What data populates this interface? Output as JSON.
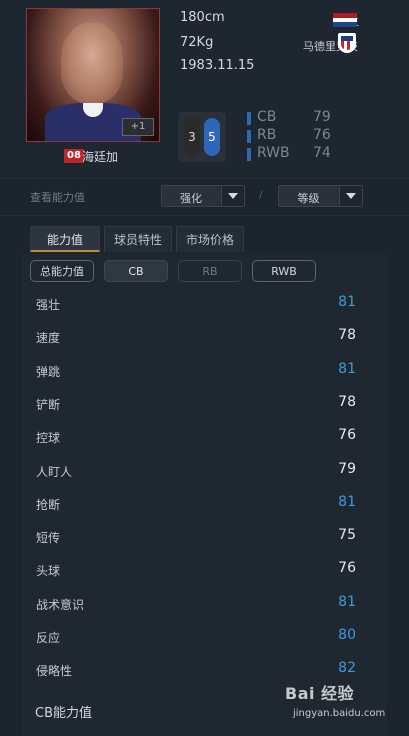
{
  "player": {
    "name": "海廷加",
    "jersey": "08",
    "plus_badge": "+1",
    "height": "180cm",
    "weight": "72Kg",
    "birthdate": "1983.11.15",
    "country": "荷兰",
    "club": "马德里竞技",
    "flag_colors": [
      "#ae1c28",
      "#ffffff",
      "#21468b"
    ]
  },
  "feet": {
    "left": "3",
    "right": "5"
  },
  "positions": [
    {
      "pos": "CB",
      "value": "79"
    },
    {
      "pos": "RB",
      "value": "76"
    },
    {
      "pos": "RWB",
      "value": "74"
    }
  ],
  "controls": {
    "label": "查看能力值",
    "enhance": "强化",
    "level": "等级",
    "separator": "/"
  },
  "tabs": [
    "能力值",
    "球员特性",
    "市场价格"
  ],
  "subtabs": [
    "总能力值",
    "CB",
    "RB",
    "RWB"
  ],
  "stats": [
    {
      "name": "强壮",
      "value": "81",
      "color": "blue"
    },
    {
      "name": "速度",
      "value": "78",
      "color": "white"
    },
    {
      "name": "弹跳",
      "value": "81",
      "color": "blue"
    },
    {
      "name": "铲断",
      "value": "78",
      "color": "white"
    },
    {
      "name": "控球",
      "value": "76",
      "color": "white"
    },
    {
      "name": "人盯人",
      "value": "79",
      "color": "white"
    },
    {
      "name": "抢断",
      "value": "81",
      "color": "blue"
    },
    {
      "name": "短传",
      "value": "75",
      "color": "white"
    },
    {
      "name": "头球",
      "value": "76",
      "color": "white"
    },
    {
      "name": "战术意识",
      "value": "81",
      "color": "blue"
    },
    {
      "name": "反应",
      "value": "80",
      "color": "blue"
    },
    {
      "name": "侵略性",
      "value": "82",
      "color": "blue"
    }
  ],
  "section_title": "CB能力值",
  "watermark": {
    "brand": "Bai 经验",
    "url": "jingyan.baidu.com"
  }
}
